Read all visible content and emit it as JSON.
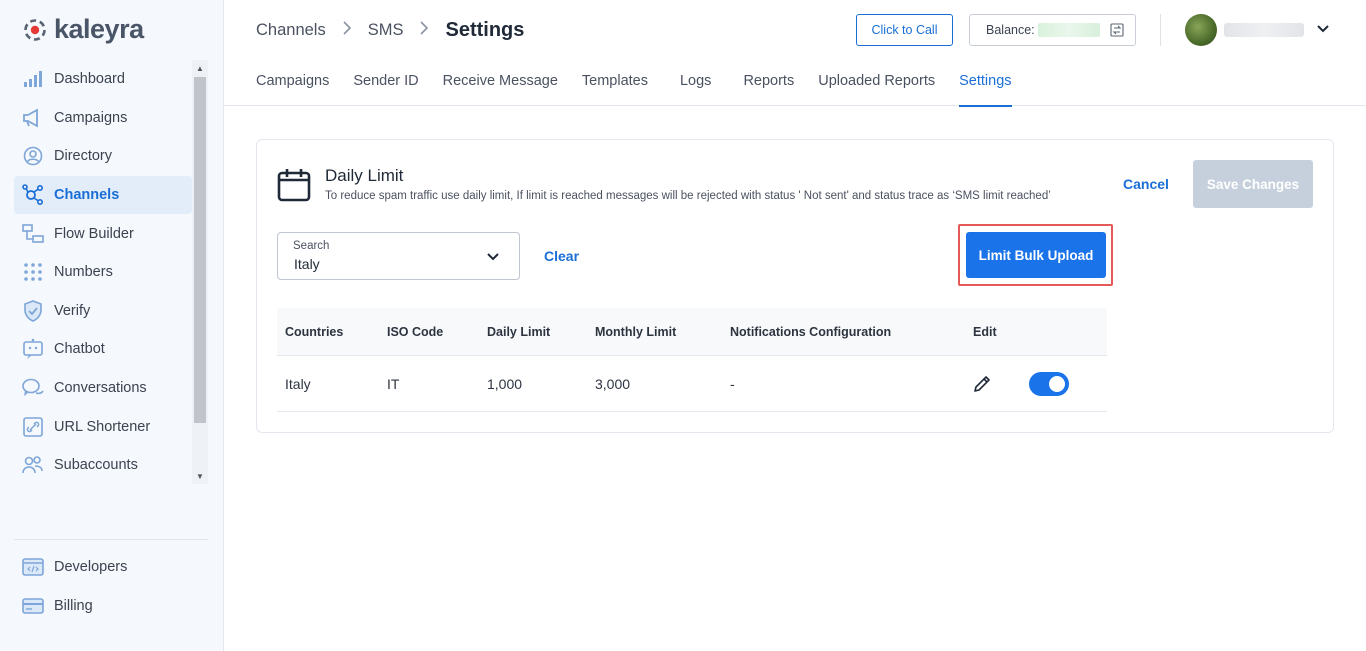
{
  "brand": {
    "name": "kaleyra",
    "accent": "#1a73e8",
    "logo_color": "#e53935"
  },
  "sidebar": {
    "items": [
      {
        "label": "Dashboard",
        "icon": "bar-chart-icon"
      },
      {
        "label": "Campaigns",
        "icon": "megaphone-icon"
      },
      {
        "label": "Directory",
        "icon": "contact-circle-icon"
      },
      {
        "label": "Channels",
        "icon": "channels-network-icon",
        "active": true
      },
      {
        "label": "Flow Builder",
        "icon": "flow-builder-icon"
      },
      {
        "label": "Numbers",
        "icon": "dialpad-icon"
      },
      {
        "label": "Verify",
        "icon": "shield-check-icon"
      },
      {
        "label": "Chatbot",
        "icon": "chatbot-icon"
      },
      {
        "label": "Conversations",
        "icon": "chat-bubbles-icon"
      },
      {
        "label": "URL Shortener",
        "icon": "link-icon"
      },
      {
        "label": "Subaccounts",
        "icon": "users-icon"
      }
    ],
    "bottom_items": [
      {
        "label": "Developers",
        "icon": "code-window-icon"
      },
      {
        "label": "Billing",
        "icon": "credit-card-icon"
      }
    ]
  },
  "header": {
    "breadcrumb": [
      "Channels",
      "SMS"
    ],
    "current": "Settings",
    "click_to_call": "Click to Call",
    "balance_label": "Balance:"
  },
  "tabs": [
    {
      "label": "Campaigns"
    },
    {
      "label": "Sender ID"
    },
    {
      "label": "Receive Message"
    },
    {
      "label": "Templates"
    },
    {
      "label": "Logs"
    },
    {
      "label": "Reports"
    },
    {
      "label": "Uploaded Reports"
    },
    {
      "label": "Settings",
      "active": true
    }
  ],
  "card": {
    "title": "Daily Limit",
    "description": "To reduce spam traffic use daily limit, If limit is reached messages will be rejected with status ' Not sent' and status trace as ‘SMS limit reached’",
    "cancel_label": "Cancel",
    "save_label": "Save Changes",
    "search": {
      "label": "Search",
      "value": "Italy"
    },
    "clear_label": "Clear",
    "bulk_label": "Limit Bulk Upload"
  },
  "table": {
    "headers": [
      "Countries",
      "ISO Code",
      "Daily Limit",
      "Monthly Limit",
      "Notifications Configuration",
      "Edit"
    ],
    "rows": [
      {
        "country": "Italy",
        "iso": "IT",
        "daily": "1,000",
        "monthly": "3,000",
        "notifications": "-",
        "enabled": true
      }
    ]
  }
}
